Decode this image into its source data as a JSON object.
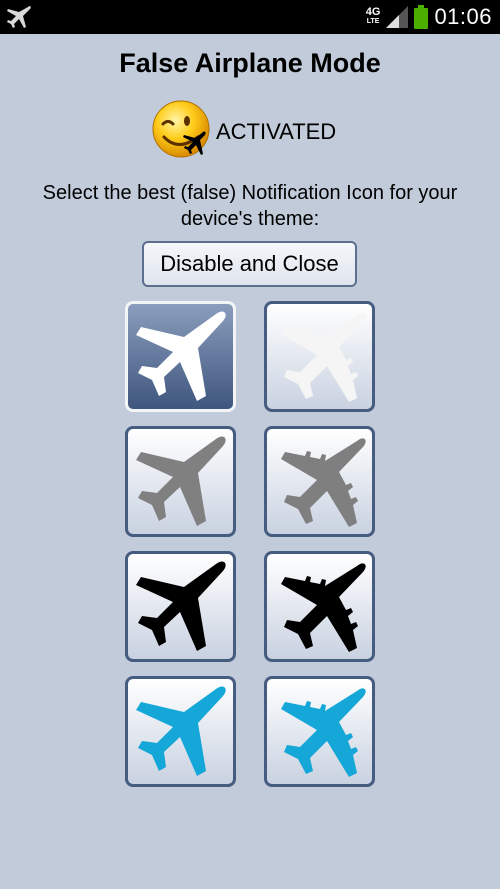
{
  "statusbar": {
    "network": "4G",
    "network_sub": "LTE",
    "time": "01:06",
    "left_icon": "airplane-icon",
    "signal_icon": "signal-icon",
    "battery_icon": "battery-icon",
    "battery_color": "#4caf00"
  },
  "header": {
    "title": "False Airplane Mode"
  },
  "status": {
    "icon": "smiley-airplane-icon",
    "text": "ACTIVATED"
  },
  "instruction": "Select the best (false) Notification Icon for your device's theme:",
  "actions": {
    "disable_close_label": "Disable and Close"
  },
  "icon_options": [
    {
      "style": "plane-simple",
      "color": "#ffffff",
      "selected": true
    },
    {
      "style": "plane-jumbo",
      "color": "#f5f5f5",
      "selected": false
    },
    {
      "style": "plane-simple",
      "color": "#808080",
      "selected": false
    },
    {
      "style": "plane-jumbo",
      "color": "#7f7f7f",
      "selected": false
    },
    {
      "style": "plane-simple",
      "color": "#000000",
      "selected": false
    },
    {
      "style": "plane-jumbo",
      "color": "#000000",
      "selected": false
    },
    {
      "style": "plane-simple",
      "color": "#14a7d8",
      "selected": false
    },
    {
      "style": "plane-jumbo",
      "color": "#14a7d8",
      "selected": false
    }
  ]
}
